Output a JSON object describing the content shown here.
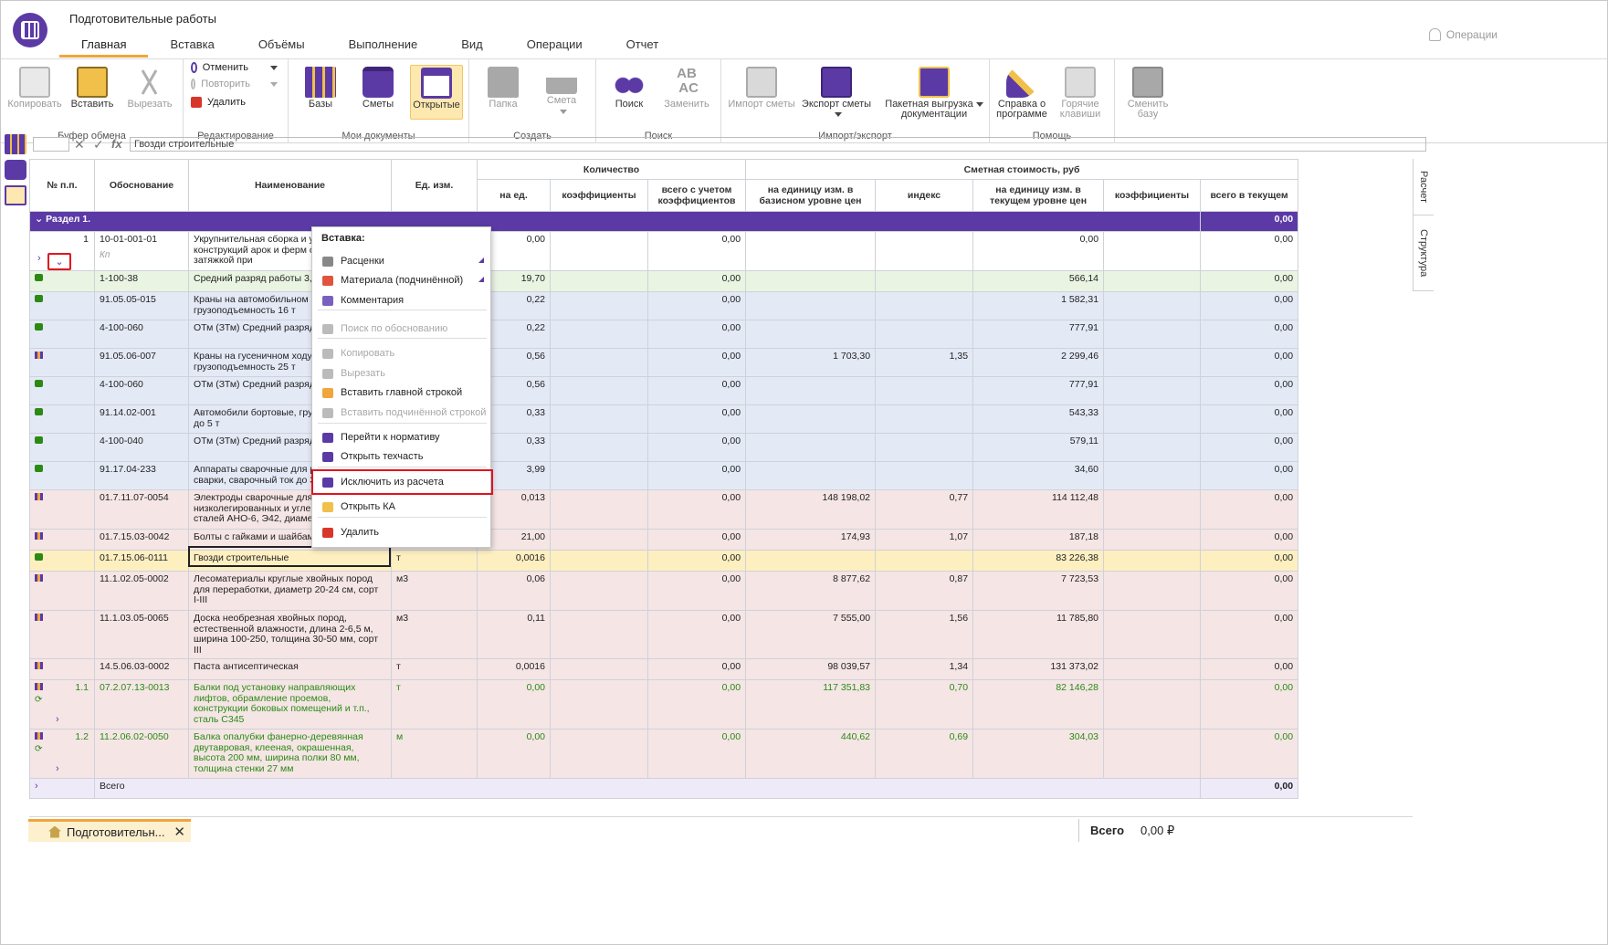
{
  "app": {
    "title": "Подготовительные работы"
  },
  "tabs": [
    "Главная",
    "Вставка",
    "Объёмы",
    "Выполнение",
    "Вид",
    "Операции",
    "Отчет"
  ],
  "operations": "Операции",
  "ribbon": {
    "clipboard": {
      "label": "Буфер обмена",
      "copy": "Копировать",
      "paste": "Вставить",
      "cut": "Вырезать"
    },
    "editing": {
      "label": "Редактирование",
      "undo": "Отменить",
      "redo": "Повторить",
      "delete": "Удалить"
    },
    "mydocs": {
      "label": "Мои документы",
      "bases": "Базы",
      "estimates": "Сметы",
      "open": "Открытые"
    },
    "create": {
      "label": "Создать",
      "folder": "Папка",
      "estimate": "Смета"
    },
    "search": {
      "label": "Поиск",
      "search": "Поиск",
      "replace": "Заменить"
    },
    "importexport": {
      "label": "Импорт/экспорт",
      "import": "Импорт сметы",
      "export": "Экспорт сметы",
      "batch1": "Пакетная выгрузка",
      "batch2": "документации"
    },
    "help": {
      "label": "Помощь",
      "about1": "Справка о",
      "about2": "программе",
      "hotkeys1": "Горячие",
      "hotkeys2": "клавиши"
    },
    "base": {
      "change1": "Сменить",
      "change2": "базу"
    }
  },
  "formula": {
    "value": "Гвозди строительные",
    "fx": "fx"
  },
  "grid": {
    "headers": {
      "num": "№ п.п.",
      "basis": "Обоснование",
      "name": "Наименование",
      "unit": "Ед. изм.",
      "qty": "Количество",
      "cost": "Сметная стоимость, руб",
      "per_unit": "на ед.",
      "coefs": "коэффициенты",
      "total_with": "всего с учетом коэффициентов",
      "base_price": "на единицу изм. в базисном уровне цен",
      "index": "индекс",
      "cur_price": "на единицу изм. в текущем уровне цен",
      "coefs2": "коэффициенты",
      "total_cur": "всего в текущем"
    },
    "section": {
      "title": "Раздел 1.",
      "total": "0,00"
    },
    "rows": [
      {
        "cls": "white",
        "ico": "",
        "num": "1",
        "basis": "10-01-001-01",
        "name": "Укрупнительная сборка и установка конструкций арок и ферм с металлической затяжкой при",
        "unit": "",
        "q": "0,00",
        "k": "",
        "t": "0,00",
        "bp": "",
        "idx": "",
        "cp": "0,00",
        "k2": "",
        "tot": "0,00",
        "sub": "Кп"
      },
      {
        "cls": "green",
        "ico": "c",
        "num": "",
        "basis": "1-100-38",
        "name": "Средний разряд работы 3,8",
        "unit": "",
        "q": "19,70",
        "k": "",
        "t": "0,00",
        "bp": "",
        "idx": "",
        "cp": "566,14",
        "k2": "",
        "tot": "0,00"
      },
      {
        "cls": "blue",
        "ico": "c",
        "num": "",
        "basis": "91.05.05-015",
        "name": "Краны на автомобильном ходу, грузоподъемность 16 т",
        "unit": "",
        "q": "0,22",
        "k": "",
        "t": "0,00",
        "bp": "",
        "idx": "",
        "cp": "1 582,31",
        "k2": "",
        "tot": "0,00"
      },
      {
        "cls": "blue",
        "ico": "c",
        "num": "",
        "basis": "4-100-060",
        "name": "ОТм (ЗТм) Средний разряд 6,0",
        "unit": "",
        "q": "0,22",
        "k": "",
        "t": "0,00",
        "bp": "",
        "idx": "",
        "cp": "777,91",
        "k2": "",
        "tot": "0,00"
      },
      {
        "cls": "blue",
        "ico": "b",
        "num": "",
        "basis": "91.05.06-007",
        "name": "Краны на гусеничном ходу, грузоподъемность 25 т",
        "unit": "",
        "q": "0,56",
        "k": "",
        "t": "0,00",
        "bp": "1 703,30",
        "idx": "1,35",
        "cp": "2 299,46",
        "k2": "",
        "tot": "0,00"
      },
      {
        "cls": "blue",
        "ico": "c",
        "num": "",
        "basis": "4-100-060",
        "name": "ОТм (ЗТм) Средний разряд 6,0",
        "unit": "",
        "q": "0,56",
        "k": "",
        "t": "0,00",
        "bp": "",
        "idx": "",
        "cp": "777,91",
        "k2": "",
        "tot": "0,00"
      },
      {
        "cls": "blue",
        "ico": "c",
        "num": "",
        "basis": "91.14.02-001",
        "name": "Автомобили бортовые, грузоподъемность до 5 т",
        "unit": "",
        "q": "0,33",
        "k": "",
        "t": "0,00",
        "bp": "",
        "idx": "",
        "cp": "543,33",
        "k2": "",
        "tot": "0,00"
      },
      {
        "cls": "blue",
        "ico": "c",
        "num": "",
        "basis": "4-100-040",
        "name": "ОТм (ЗТм) Средний разряд 4,0",
        "unit": "",
        "q": "0,33",
        "k": "",
        "t": "0,00",
        "bp": "",
        "idx": "",
        "cp": "579,11",
        "k2": "",
        "tot": "0,00"
      },
      {
        "cls": "blue",
        "ico": "c",
        "num": "",
        "basis": "91.17.04-233",
        "name": "Аппараты сварочные для ручной дуговой сварки, сварочный ток до 350 А",
        "unit": "",
        "q": "3,99",
        "k": "",
        "t": "0,00",
        "bp": "",
        "idx": "",
        "cp": "34,60",
        "k2": "",
        "tot": "0,00"
      },
      {
        "cls": "pink",
        "ico": "b",
        "num": "",
        "basis": "01.7.11.07-0054",
        "name": "Электроды сварочные для сварки низколегированных и углеродистых сталей АНО-6, Э42, диаметр",
        "unit": "",
        "q": "0,013",
        "k": "",
        "t": "0,00",
        "bp": "148 198,02",
        "idx": "0,77",
        "cp": "114 112,48",
        "k2": "",
        "tot": "0,00"
      },
      {
        "cls": "pink",
        "ico": "b",
        "num": "",
        "basis": "01.7.15.03-0042",
        "name": "Болты с гайками и шайбами",
        "unit": "",
        "q": "21,00",
        "k": "",
        "t": "0,00",
        "bp": "174,93",
        "idx": "1,07",
        "cp": "187,18",
        "k2": "",
        "tot": "0,00"
      },
      {
        "cls": "yellow",
        "ico": "c",
        "num": "",
        "basis": "01.7.15.06-0111",
        "name": "Гвозди строительные",
        "unit": "т",
        "q": "0,0016",
        "k": "",
        "t": "0,00",
        "bp": "",
        "idx": "",
        "cp": "83 226,38",
        "k2": "",
        "tot": "0,00"
      },
      {
        "cls": "pink",
        "ico": "b",
        "num": "",
        "basis": "11.1.02.05-0002",
        "name": "Лесоматериалы круглые хвойных пород для переработки, диаметр 20-24 см, сорт I-III",
        "unit": "м3",
        "q": "0,06",
        "k": "",
        "t": "0,00",
        "bp": "8 877,62",
        "idx": "0,87",
        "cp": "7 723,53",
        "k2": "",
        "tot": "0,00"
      },
      {
        "cls": "pink",
        "ico": "b",
        "num": "",
        "basis": "11.1.03.05-0065",
        "name": "Доска необрезная хвойных пород, естественной влажности, длина 2-6,5 м, ширина 100-250, толщина 30-50 мм, сорт III",
        "unit": "м3",
        "q": "0,11",
        "k": "",
        "t": "0,00",
        "bp": "7 555,00",
        "idx": "1,56",
        "cp": "11 785,80",
        "k2": "",
        "tot": "0,00"
      },
      {
        "cls": "pink",
        "ico": "b",
        "num": "",
        "basis": "14.5.06.03-0002",
        "name": "Паста антисептическая",
        "unit": "т",
        "q": "0,0016",
        "k": "",
        "t": "0,00",
        "bp": "98 039,57",
        "idx": "1,34",
        "cp": "131 373,02",
        "k2": "",
        "tot": "0,00"
      },
      {
        "cls": "pink gtext",
        "ico": "b",
        "num": "1.1",
        "basis": "07.2.07.13-0013",
        "name": "Балки под установку направляющих лифтов, обрамление проемов, конструкции боковых помещений и т.п., сталь С345",
        "unit": "т",
        "q": "0,00",
        "k": "",
        "t": "0,00",
        "bp": "117 351,83",
        "idx": "0,70",
        "cp": "82 146,28",
        "k2": "",
        "tot": "0,00",
        "exp": true
      },
      {
        "cls": "pink gtext",
        "ico": "b",
        "num": "1.2",
        "basis": "11.2.06.02-0050",
        "name": "Балка опалубки фанерно-деревянная двутавровая, клееная, окрашенная, высота 200 мм, ширина полки 80 мм, толщина стенки 27 мм",
        "unit": "м",
        "q": "0,00",
        "k": "",
        "t": "0,00",
        "bp": "440,62",
        "idx": "0,69",
        "cp": "304,03",
        "k2": "",
        "tot": "0,00",
        "exp": true
      }
    ],
    "total_row": {
      "label": "Всего",
      "total": "0,00"
    }
  },
  "menu": {
    "header": "Вставка:",
    "items": [
      "Расценки",
      "Материала (подчинённой)",
      "Комментария",
      "Поиск по обоснованию",
      "Копировать",
      "Вырезать",
      "Вставить главной строкой",
      "Вставить подчинённой строкой",
      "Перейти к нормативу",
      "Открыть техчасть",
      "Исключить из расчета",
      "Открыть КА",
      "Удалить"
    ]
  },
  "side_tabs": [
    "Расчет",
    "Структура"
  ],
  "doc_tab": "Подготовительн...",
  "status": {
    "label": "Всего",
    "value": "0,00 ₽"
  },
  "colors": {
    "accent": "#5b3aa6",
    "highlight": "#f0a63c",
    "alert": "#e0141e"
  }
}
